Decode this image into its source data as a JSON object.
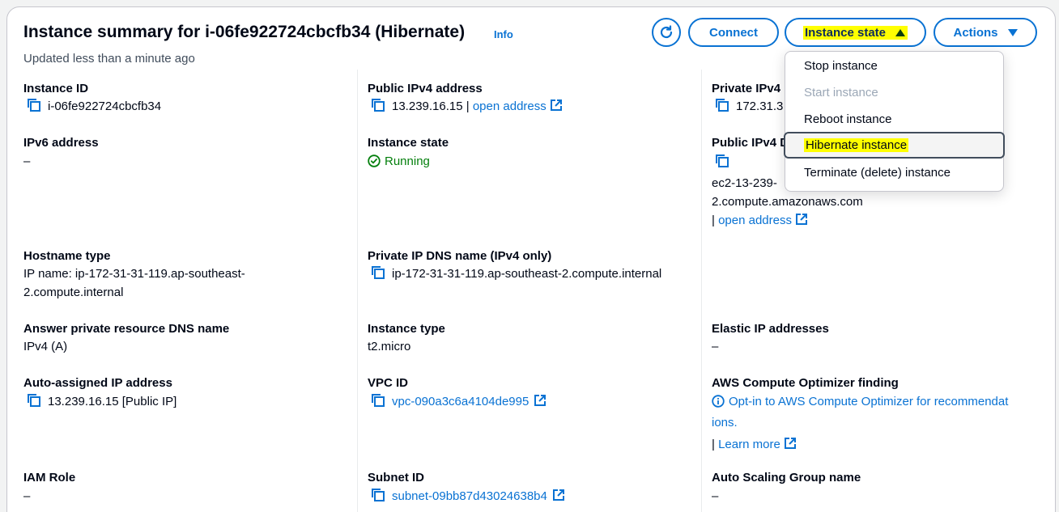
{
  "header": {
    "title": "Instance summary for i-06fe922724cbcfb34 (Hibernate)",
    "info": "Info",
    "subtitle": "Updated less than a minute ago",
    "connect": "Connect",
    "instance_state": "Instance state",
    "actions": "Actions"
  },
  "menu": {
    "stop": "Stop instance",
    "start": "Start instance",
    "reboot": "Reboot instance",
    "hibernate": "Hibernate instance",
    "terminate": "Terminate (delete) instance"
  },
  "col1": {
    "instance_id_label": "Instance ID",
    "instance_id": "i-06fe922724cbcfb34",
    "ipv6_label": "IPv6 address",
    "ipv6": "–",
    "hostname_label": "Hostname type",
    "hostname_line1": "IP name: ip-172-31-31-119.ap-southeast-",
    "hostname_line2": "2.compute.internal",
    "answer_dns_label": "Answer private resource DNS name",
    "answer_dns": "IPv4 (A)",
    "auto_ip_label": "Auto-assigned IP address",
    "auto_ip": "13.239.16.15 [Public IP]",
    "iam_label": "IAM Role",
    "iam": "–"
  },
  "col2": {
    "public_ipv4_label": "Public IPv4 address",
    "public_ipv4": "13.239.16.15",
    "sep": "|",
    "open_address": "open address",
    "state_label": "Instance state",
    "state": "Running",
    "private_dns_label": "Private IP DNS name (IPv4 only)",
    "private_dns": "ip-172-31-31-119.ap-southeast-2.compute.internal",
    "type_label": "Instance type",
    "type": "t2.micro",
    "vpc_label": "VPC ID",
    "vpc": "vpc-090a3c6a4104de995",
    "subnet_label": "Subnet ID",
    "subnet": "subnet-09bb87d43024638b4"
  },
  "col3": {
    "private_ipv4_label": "Private IPv4",
    "private_ipv4": "172.31.3",
    "public_dns_label": "Public IPv4 D",
    "public_dns_line1": "ec2-13-239-",
    "public_dns_line2": "2.compute.amazonaws.com",
    "sep": "|",
    "open_address": "open address",
    "elastic_label": "Elastic IP addresses",
    "elastic": "–",
    "optimizer_label": "AWS Compute Optimizer finding",
    "optimizer_line1": "Opt-in to AWS Compute Optimizer for recommendat",
    "optimizer_line2": "ions.",
    "learn_more": "Learn more",
    "asg_label": "Auto Scaling Group name",
    "asg": "–"
  },
  "colors": {
    "link": "#0972d3",
    "success": "#037f0c",
    "highlight": "#ffff00"
  }
}
